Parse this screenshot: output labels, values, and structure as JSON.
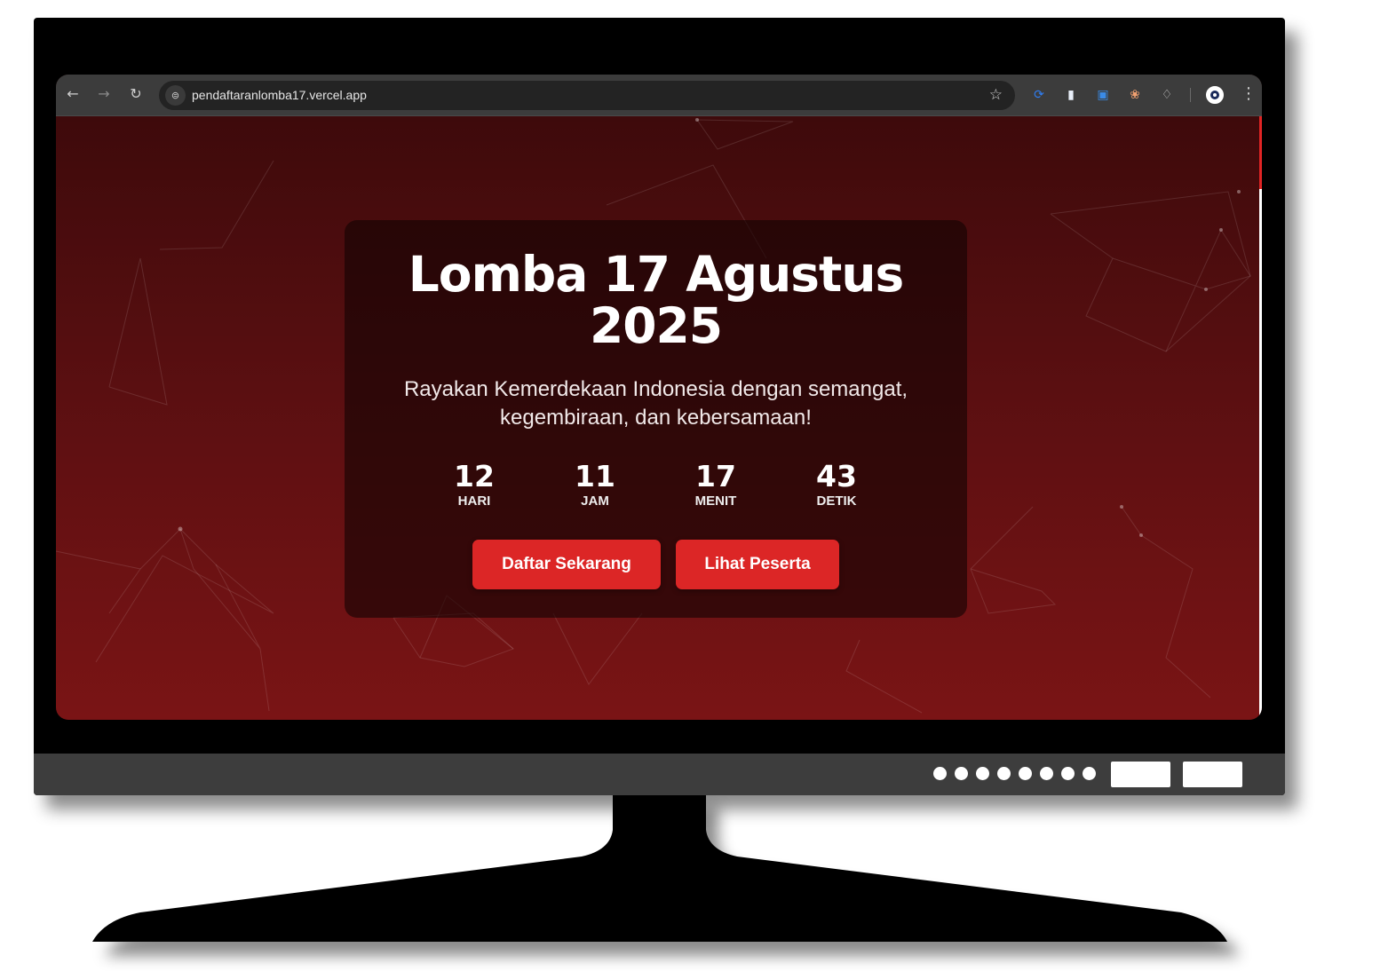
{
  "browser": {
    "url": "pendaftaranlomba17.vercel.app",
    "icons": [
      "back-arrow-icon",
      "forward-arrow-icon",
      "reload-icon",
      "site-info-icon",
      "bookmark-star-icon",
      "extension-icons",
      "profile-avatar-icon",
      "more-menu-icon"
    ]
  },
  "hero": {
    "title_line1": "Lomba 17 Agustus",
    "title_line2": "2025",
    "subtitle_line1": "Rayakan Kemerdekaan Indonesia dengan semangat,",
    "subtitle_line2": "kegembiraan, dan kebersamaan!"
  },
  "countdown": [
    {
      "value": "12",
      "label": "HARI"
    },
    {
      "value": "11",
      "label": "JAM"
    },
    {
      "value": "17",
      "label": "MENIT"
    },
    {
      "value": "43",
      "label": "DETIK"
    }
  ],
  "buttons": {
    "register": "Daftar Sekarang",
    "participants": "Lihat Peserta"
  },
  "colors": {
    "accent": "#dc2626",
    "background_top": "#3e0a0b",
    "background_bottom": "#7a1415"
  }
}
